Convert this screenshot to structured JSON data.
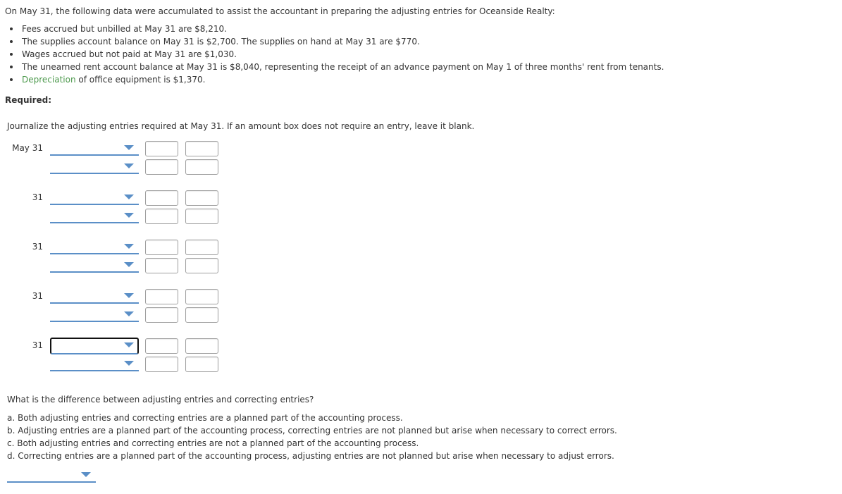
{
  "intro": "On May 31, the following data were accumulated to assist the accountant in preparing the adjusting entries for Oceanside Realty:",
  "bullets": [
    {
      "text": "Fees accrued but unbilled at May 31 are $8,210."
    },
    {
      "text": "The supplies account balance on May 31 is $2,700. The supplies on hand at May 31 are $770."
    },
    {
      "text": "Wages accrued but not paid at May 31 are $1,030."
    },
    {
      "text": "The unearned rent account balance at May 31 is $8,040, representing the receipt of an advance payment on May 1 of three months' rent from tenants."
    },
    {
      "link": "Depreciation",
      "text": " of office equipment is $1,370."
    }
  ],
  "required_label": "Required:",
  "instruction": "Journalize the adjusting entries required at May 31. If an amount box does not require an entry, leave it blank.",
  "entries": [
    {
      "date": "May 31",
      "rows": [
        {
          "account": "",
          "debit": "",
          "credit": ""
        },
        {
          "account": "",
          "debit": "",
          "credit": ""
        }
      ]
    },
    {
      "date": "31",
      "rows": [
        {
          "account": "",
          "debit": "",
          "credit": ""
        },
        {
          "account": "",
          "debit": "",
          "credit": ""
        }
      ]
    },
    {
      "date": "31",
      "rows": [
        {
          "account": "",
          "debit": "",
          "credit": ""
        },
        {
          "account": "",
          "debit": "",
          "credit": ""
        }
      ]
    },
    {
      "date": "31",
      "rows": [
        {
          "account": "",
          "debit": "",
          "credit": ""
        },
        {
          "account": "",
          "debit": "",
          "credit": ""
        }
      ]
    },
    {
      "date": "31",
      "rows": [
        {
          "account": "",
          "debit": "",
          "credit": ""
        },
        {
          "account": "",
          "debit": "",
          "credit": ""
        }
      ]
    }
  ],
  "question": "What is the difference between adjusting entries and correcting entries?",
  "options": [
    "a. Both adjusting entries and correcting entries are a planned part of the accounting process.",
    "b. Adjusting entries are a planned part of the accounting process, correcting entries are not planned but arise when necessary to correct errors.",
    "c. Both adjusting entries and correcting entries are not a planned part of the accounting process.",
    "d. Correcting entries are a planned part of the accounting process, adjusting entries are not planned but arise when necessary to adjust errors."
  ],
  "answer_selected": "",
  "colors": {
    "link": "#4e9a4e",
    "dropdown_accent": "#5b8fc7",
    "text": "#333333"
  }
}
